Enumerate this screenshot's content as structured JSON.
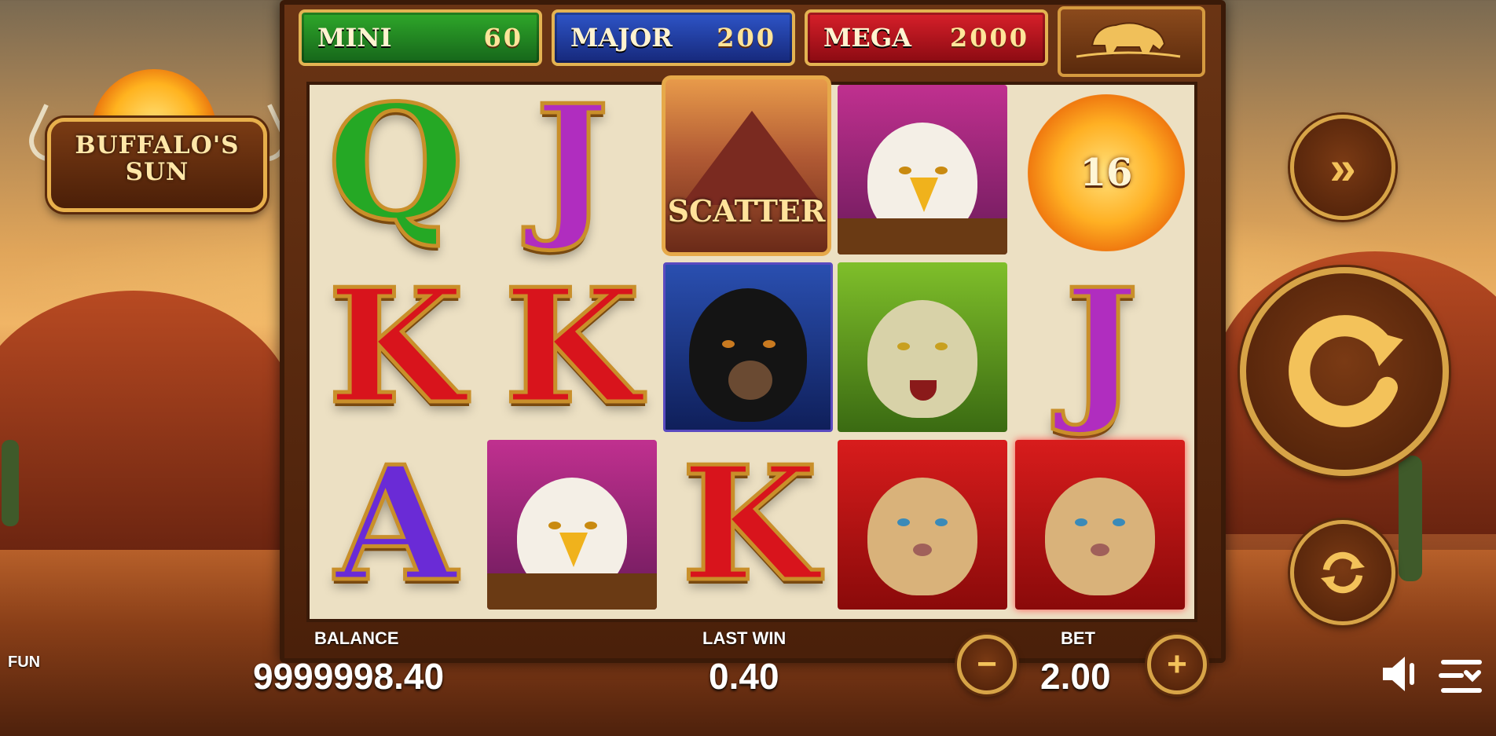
{
  "game": {
    "logo_line1": "BUFFALO'S",
    "logo_line2": "SUN",
    "mode": "FUN"
  },
  "jackpots": [
    {
      "label": "MINI",
      "value": "60",
      "color": "#1f8a1c"
    },
    {
      "label": "MAJOR",
      "value": "200",
      "color": "#1c3a94"
    },
    {
      "label": "MEGA",
      "value": "2000",
      "color": "#b0111b"
    }
  ],
  "reels": {
    "row1": [
      "Q",
      "J",
      "SCATTER",
      "eagle",
      "sun"
    ],
    "row2": [
      "K",
      "K",
      "bear",
      "wolf",
      "J"
    ],
    "row3": [
      "A",
      "eagle",
      "K",
      "cougar",
      "cougar"
    ],
    "sun_value": "16",
    "scatter_label": "SCATTER"
  },
  "symbol_colors": {
    "Q": "#25a825",
    "J": "#b02dbf",
    "K": "#d8141c",
    "A": "#6a2bd6"
  },
  "footer": {
    "balance_label": "BALANCE",
    "balance_value": "9999998.40",
    "last_win_label": "LAST WIN",
    "last_win_value": "0.40",
    "bet_label": "BET",
    "bet_value": "2.00",
    "minus": "−",
    "plus": "+"
  },
  "controls": {
    "turbo_icon": "double-chevron-icon",
    "spin_icon": "spin-icon",
    "autoplay_icon": "autoplay-icon",
    "sound_icon": "speaker-icon",
    "menu_icon": "menu-icon"
  }
}
